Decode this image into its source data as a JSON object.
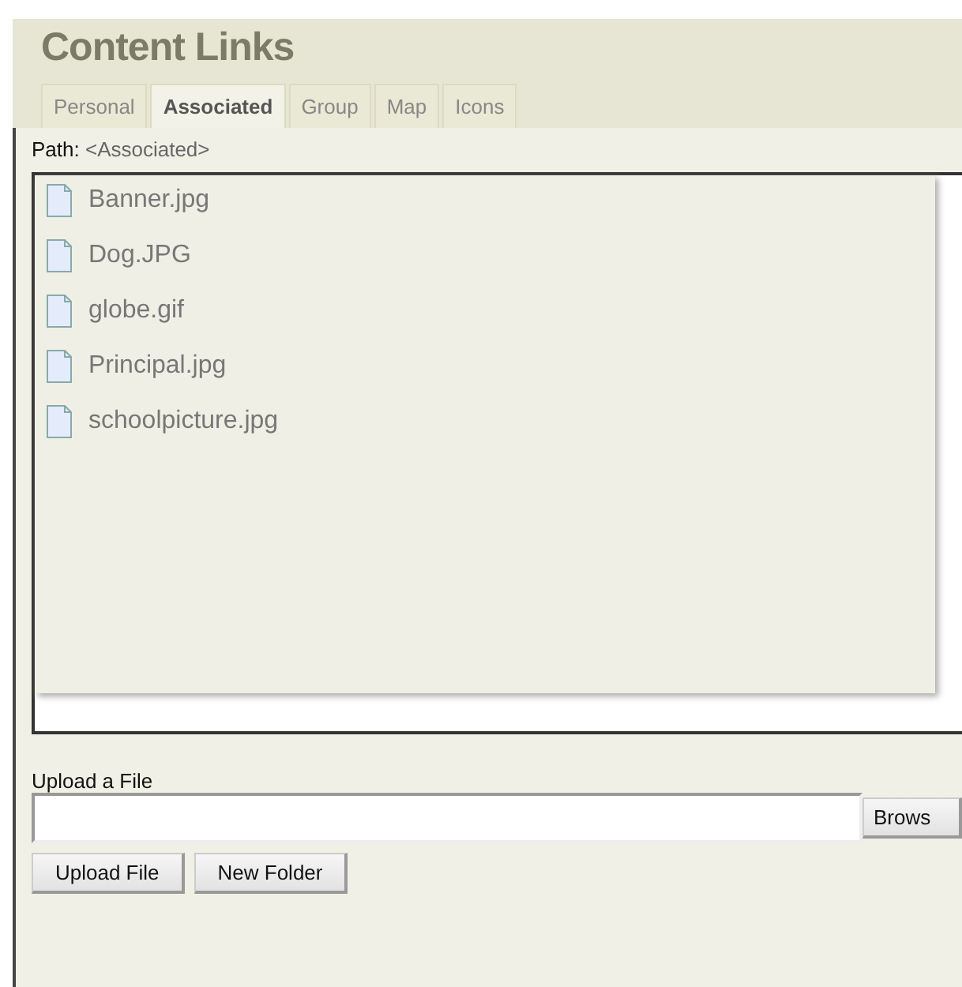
{
  "title": "Content Links",
  "tabs": [
    {
      "label": "Personal",
      "selected": false
    },
    {
      "label": "Associated",
      "selected": true
    },
    {
      "label": "Group",
      "selected": false
    },
    {
      "label": "Map",
      "selected": false
    },
    {
      "label": "Icons",
      "selected": false
    }
  ],
  "path": {
    "label": "Path:",
    "value": "<Associated>"
  },
  "files": [
    {
      "name": "Banner.jpg"
    },
    {
      "name": "Dog.JPG"
    },
    {
      "name": "globe.gif"
    },
    {
      "name": "Principal.jpg"
    },
    {
      "name": "schoolpicture.jpg"
    }
  ],
  "upload": {
    "label": "Upload a File",
    "browse": "Brows"
  },
  "buttons": [
    "Upload File",
    "New Folder"
  ]
}
